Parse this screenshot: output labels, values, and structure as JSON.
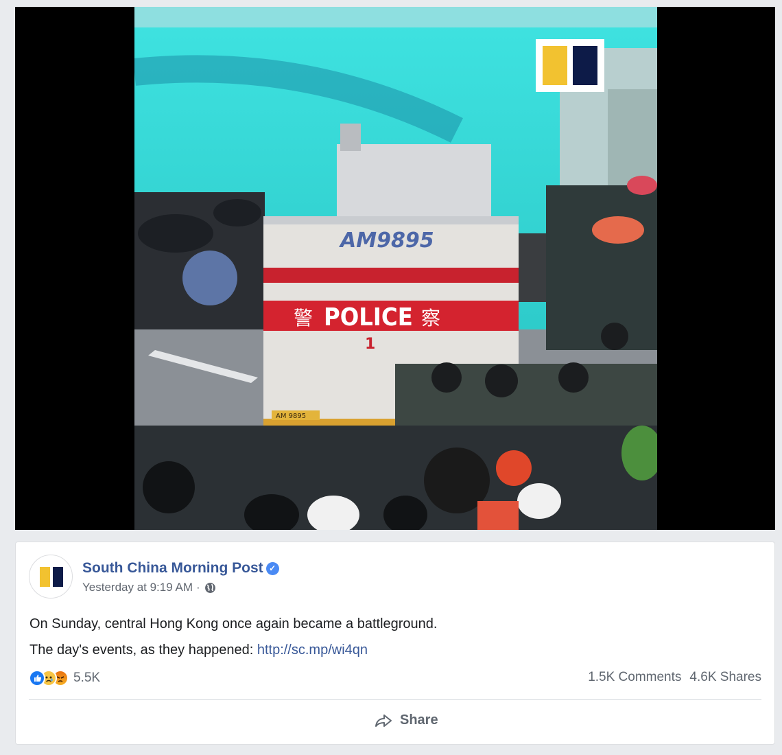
{
  "media": {
    "vehicle_plate": "AM9895",
    "vehicle_label": "POLICE",
    "vehicle_label_cn_left": "警",
    "vehicle_label_cn_right": "察",
    "vehicle_number": "1",
    "small_plate": "AM 9895",
    "logo_colors": {
      "yellow": "#f2c230",
      "navy": "#0d1b48"
    },
    "dye_color": "#2fd6d9"
  },
  "post": {
    "page_name": "South China Morning Post",
    "verified_icon": "check-icon",
    "timestamp": "Yesterday at 9:19 AM",
    "separator": "·",
    "privacy_icon": "globe-icon",
    "text_line1": "On Sunday, central Hong Kong once again became a battleground.",
    "text_line2_prefix": "The day's events, as they happened: ",
    "link_text": "http://sc.mp/wi4qn",
    "reactions": [
      "like-icon",
      "sad-icon",
      "angry-icon"
    ],
    "reaction_count": "5.5K",
    "comments": "1.5K Comments",
    "shares": "4.6K Shares",
    "share_label": "Share"
  },
  "colors": {
    "link": "#385898",
    "meta": "#616770"
  }
}
